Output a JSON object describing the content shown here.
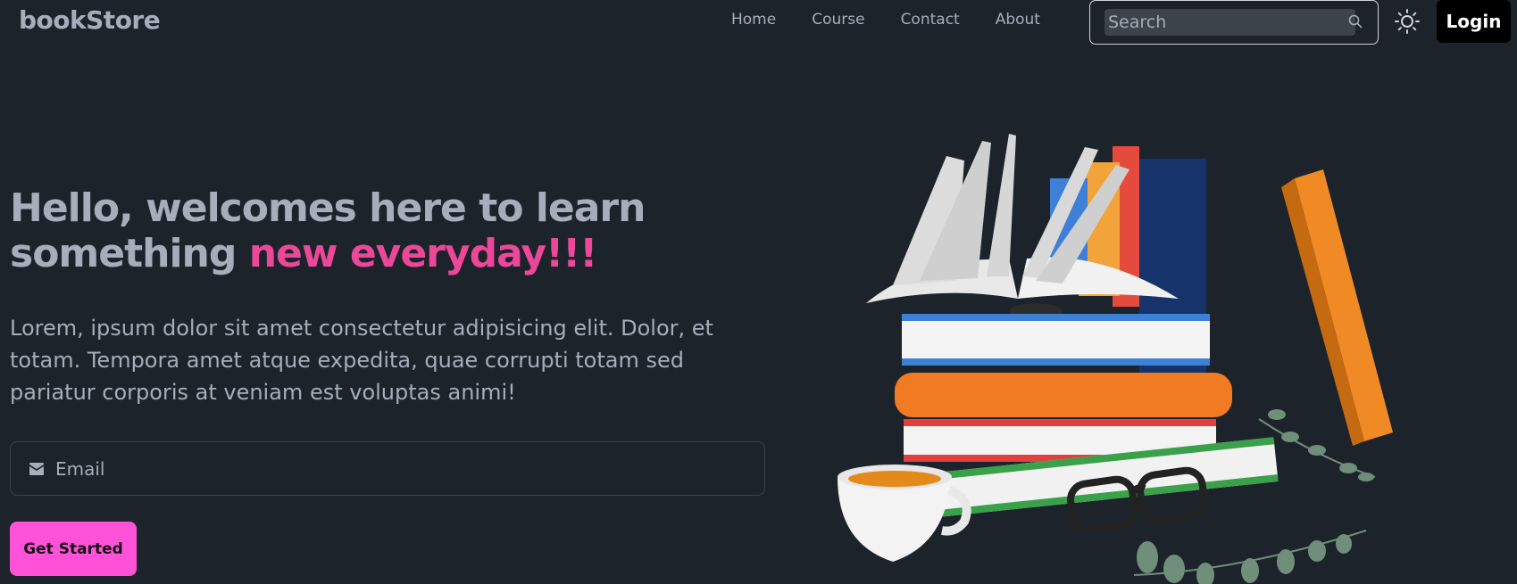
{
  "header": {
    "logo": "bookStore",
    "nav": [
      {
        "label": "Home"
      },
      {
        "label": "Course"
      },
      {
        "label": "Contact"
      },
      {
        "label": "About"
      }
    ],
    "search_placeholder": "Search",
    "login_label": "Login"
  },
  "hero": {
    "title_part1": "Hello, welcomes here to learn something ",
    "title_accent": "new everyday!!!",
    "description": "Lorem, ipsum dolor sit amet consectetur adipisicing elit. Dolor, et totam. Tempora amet atque expedita, quae corrupti totam sed pariatur corporis at veniam est voluptas animi!",
    "email_placeholder": "Email",
    "cta_label": "Get Started"
  },
  "colors": {
    "background": "#1d232a",
    "text": "#a6adbb",
    "accent": "#ec4899",
    "cta": "#ff52d9"
  },
  "icons": {
    "search": "search-icon",
    "theme": "sun-icon",
    "email": "mail-icon"
  }
}
